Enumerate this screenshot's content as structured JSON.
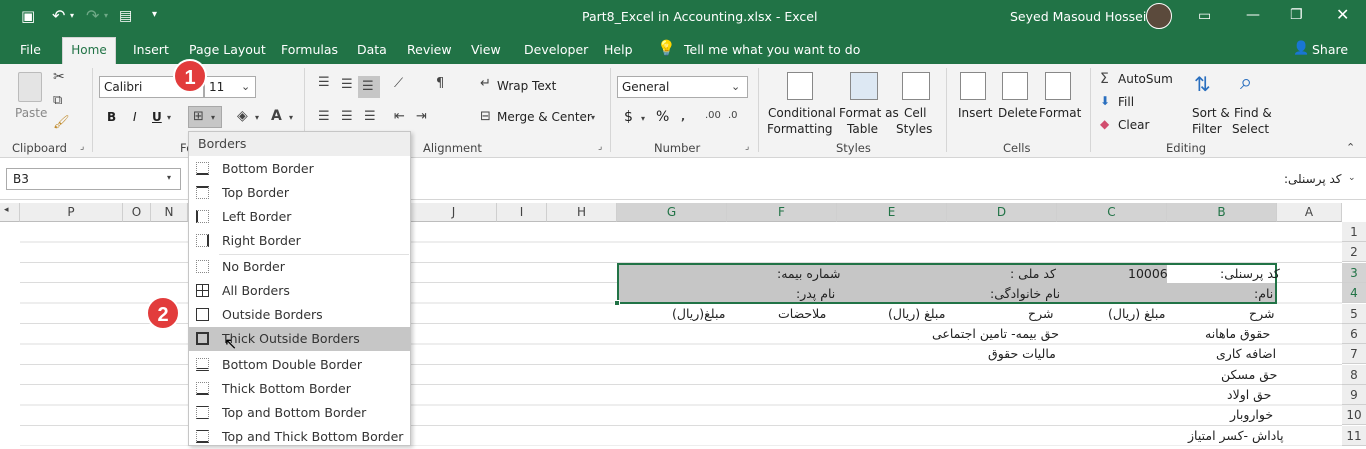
{
  "title_bar": {
    "file_title": "Part8_Excel in Accounting.xlsx - Excel",
    "user_name": "Seyed Masoud Hosseini"
  },
  "tabs": [
    "File",
    "Home",
    "Insert",
    "Page Layout",
    "Formulas",
    "Data",
    "Review",
    "View",
    "Developer",
    "Help"
  ],
  "tell_me": "Tell me what you want to do",
  "share": "Share",
  "ribbon": {
    "clipboard": {
      "paste": "Paste",
      "group": "Clipboard"
    },
    "font": {
      "name": "Calibri",
      "size": "11",
      "group": "Font",
      "bold": "B",
      "italic": "I",
      "underline": "U"
    },
    "alignment": {
      "wrap": "Wrap Text",
      "merge": "Merge & Center",
      "group": "Alignment"
    },
    "number": {
      "format": "General",
      "currency": "$",
      "percent": "%",
      "group": "Number"
    },
    "styles": {
      "conditional": "Conditional",
      "formatting": "Formatting",
      "format_as": "Format as",
      "table": "Table",
      "cell": "Cell",
      "styles_label": "Styles",
      "group": "Styles"
    },
    "cells": {
      "insert": "Insert",
      "delete": "Delete",
      "format": "Format",
      "group": "Cells"
    },
    "editing": {
      "autosum": "AutoSum",
      "fill": "Fill",
      "clear": "Clear",
      "sort": "Sort &",
      "filter": "Filter",
      "find": "Find &",
      "select": "Select",
      "group": "Editing"
    }
  },
  "formula_bar": {
    "name_box": "B3",
    "content": "کد پرسنلی:"
  },
  "columns": [
    "P",
    "O",
    "N",
    "J",
    "I",
    "H",
    "G",
    "F",
    "E",
    "D",
    "C",
    "B",
    "A"
  ],
  "rows": [
    "1",
    "2",
    "3",
    "4",
    "5",
    "6",
    "7",
    "8",
    "9",
    "10",
    "11"
  ],
  "cells": {
    "b3": "کد پرسنلی:",
    "c3": "10006",
    "d3": "کد ملی :",
    "f3": "شماره بیمه:",
    "b4": "نام:",
    "d4": "نام خانوادگی:",
    "f4": "نام پدر:",
    "b5": "شرح",
    "c5": "مبلغ (ریال)",
    "d5": "شرح",
    "e5": "مبلغ (ریال)",
    "f5": "ملاحضات",
    "g5": "مبلغ(ریال)",
    "b6": "حقوق ماهانه",
    "d6": "حق بیمه- تامین اجتماعی",
    "b7": "اضافه کاری",
    "d7": "مالیات حقوق",
    "b8": "حق مسکن",
    "b9": "حق اولاد",
    "b10": "خواروبار",
    "b11": "پاداش -کسر امتیاز"
  },
  "borders_menu": {
    "header": "Borders",
    "items": [
      "Bottom Border",
      "Top Border",
      "Left Border",
      "Right Border",
      "No Border",
      "All Borders",
      "Outside Borders",
      "Thick Outside Borders",
      "Bottom Double Border",
      "Thick Bottom Border",
      "Top and Bottom Border",
      "Top and Thick Bottom Border"
    ]
  },
  "annotations": {
    "step1": "1",
    "step2": "2"
  },
  "colors": {
    "accent": "#217346",
    "badge": "#e23c3c",
    "selection": "#c6c6c6"
  }
}
